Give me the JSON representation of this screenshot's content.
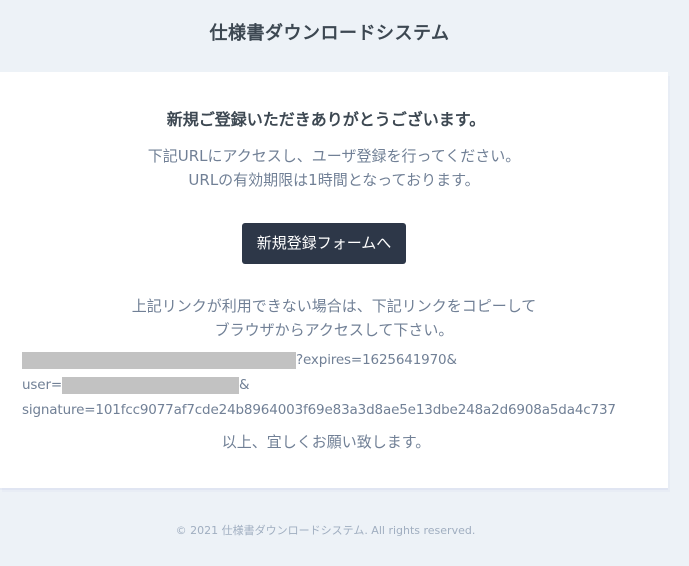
{
  "header": {
    "title": "仕様書ダウンロードシステム"
  },
  "card": {
    "greeting": "新規ご登録いただきありがとうございます。",
    "message_lines": [
      "下記URLにアクセスし、ユーザ登録を行ってください。",
      "URLの有効期限は1時間となっております。"
    ],
    "button_label": "新規登録フォームへ",
    "fallback_lines": [
      "上記リンクが利用できない場合は、下記リンクをコピーして",
      "ブラウザからアクセスして下さい。"
    ],
    "url": {
      "expires_part": "?expires=1625641970&",
      "user_prefix": "user=",
      "user_suffix": "&",
      "signature_line": "signature=101fcc9077af7cde24b8964003f69e83a3d8ae5e13dbe248a2d6908a5da4c737"
    },
    "closing": "以上、宜しくお願い致します。"
  },
  "footer": {
    "copyright": "© 2021 仕様書ダウンロードシステム. All rights reserved."
  },
  "colors": {
    "page_background": "#edf2f7",
    "card_background": "#ffffff",
    "button_background": "#2d3748",
    "heading_text": "#3d4852",
    "body_text": "#718096",
    "footer_text": "#a0aec0",
    "redaction": "#c2c2c2"
  }
}
